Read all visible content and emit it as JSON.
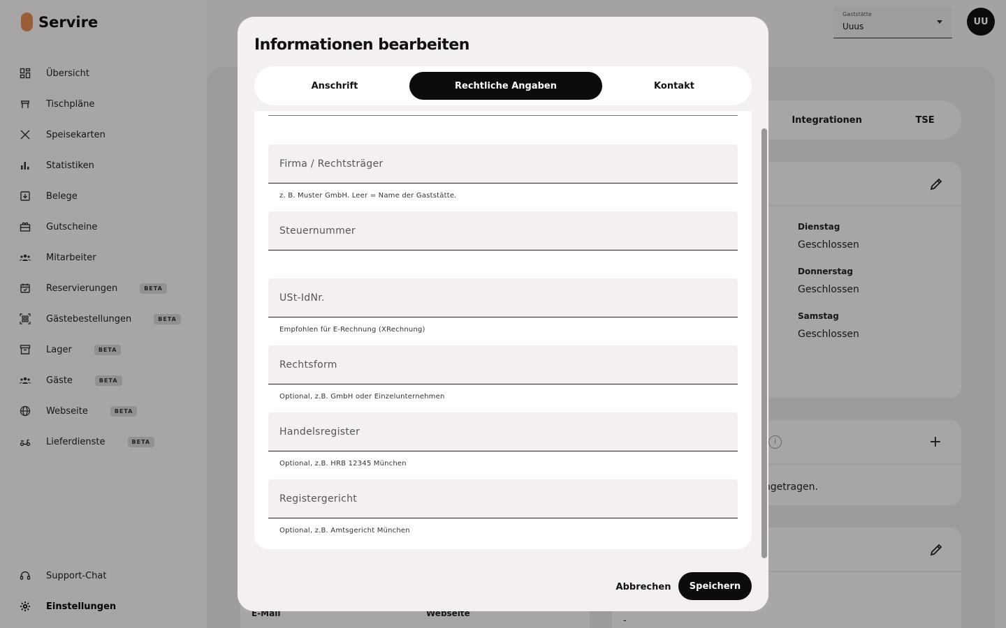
{
  "app": {
    "name": "Servire"
  },
  "sidebar": {
    "items": [
      {
        "label": "Übersicht",
        "icon": "dashboard-icon"
      },
      {
        "label": "Tischpläne",
        "icon": "table-icon"
      },
      {
        "label": "Speisekarten",
        "icon": "cutlery-icon"
      },
      {
        "label": "Statistiken",
        "icon": "bar-chart-icon"
      },
      {
        "label": "Belege",
        "icon": "receipt-icon"
      },
      {
        "label": "Gutscheine",
        "icon": "gift-icon"
      },
      {
        "label": "Mitarbeiter",
        "icon": "people-icon"
      },
      {
        "label": "Reservierungen",
        "icon": "calendar-icon",
        "badge": "BETA"
      },
      {
        "label": "Gästebestellungen",
        "icon": "qr-code-icon",
        "badge": "BETA"
      },
      {
        "label": "Lager",
        "icon": "archive-icon",
        "badge": "BETA"
      },
      {
        "label": "Gäste",
        "icon": "guests-icon",
        "badge": "BETA"
      },
      {
        "label": "Webseite",
        "icon": "globe-icon",
        "badge": "BETA"
      },
      {
        "label": "Lieferdienste",
        "icon": "scooter-icon",
        "badge": "BETA"
      }
    ],
    "bottom": [
      {
        "label": "Support-Chat",
        "icon": "support-icon"
      },
      {
        "label": "Einstellungen",
        "icon": "gear-icon"
      }
    ]
  },
  "header": {
    "venue_label": "Gaststätte",
    "venue_value": "Uuus",
    "avatar_initials": "UU"
  },
  "background": {
    "tabs": [
      "Integrationen",
      "TSE"
    ],
    "days": [
      {
        "day": "Dienstag",
        "value": "Geschlossen"
      },
      {
        "day": "Donnerstag",
        "value": "Geschlossen"
      },
      {
        "day": "Samstag",
        "value": "Geschlossen"
      }
    ],
    "partial_text": "ingetragen.",
    "dash": "-",
    "labels": [
      "E-Mail",
      "Webseite"
    ]
  },
  "modal": {
    "title": "Informationen bearbeiten",
    "tabs": [
      {
        "label": "Anschrift",
        "active": false
      },
      {
        "label": "Rechtliche Angaben",
        "active": true
      },
      {
        "label": "Kontakt",
        "active": false
      }
    ],
    "fields": [
      {
        "placeholder": "Firma / Rechtsträger",
        "value": "",
        "helper": "z. B. Muster GmbH. Leer = Name der Gaststätte."
      },
      {
        "placeholder": "Steuernummer",
        "value": "",
        "helper": ""
      },
      {
        "placeholder": "USt-IdNr.",
        "value": "",
        "helper": "Empfohlen für E-Rechnung (XRechnung)"
      },
      {
        "placeholder": "Rechtsform",
        "value": "",
        "helper": "Optional, z.B. GmbH oder Einzelunternehmen"
      },
      {
        "placeholder": "Handelsregister",
        "value": "",
        "helper": "Optional, z.B. HRB 12345 München"
      },
      {
        "placeholder": "Registergericht",
        "value": "",
        "helper": "Optional, z.B. Amtsgericht München"
      }
    ],
    "cancel_label": "Abbrechen",
    "save_label": "Speichern"
  }
}
